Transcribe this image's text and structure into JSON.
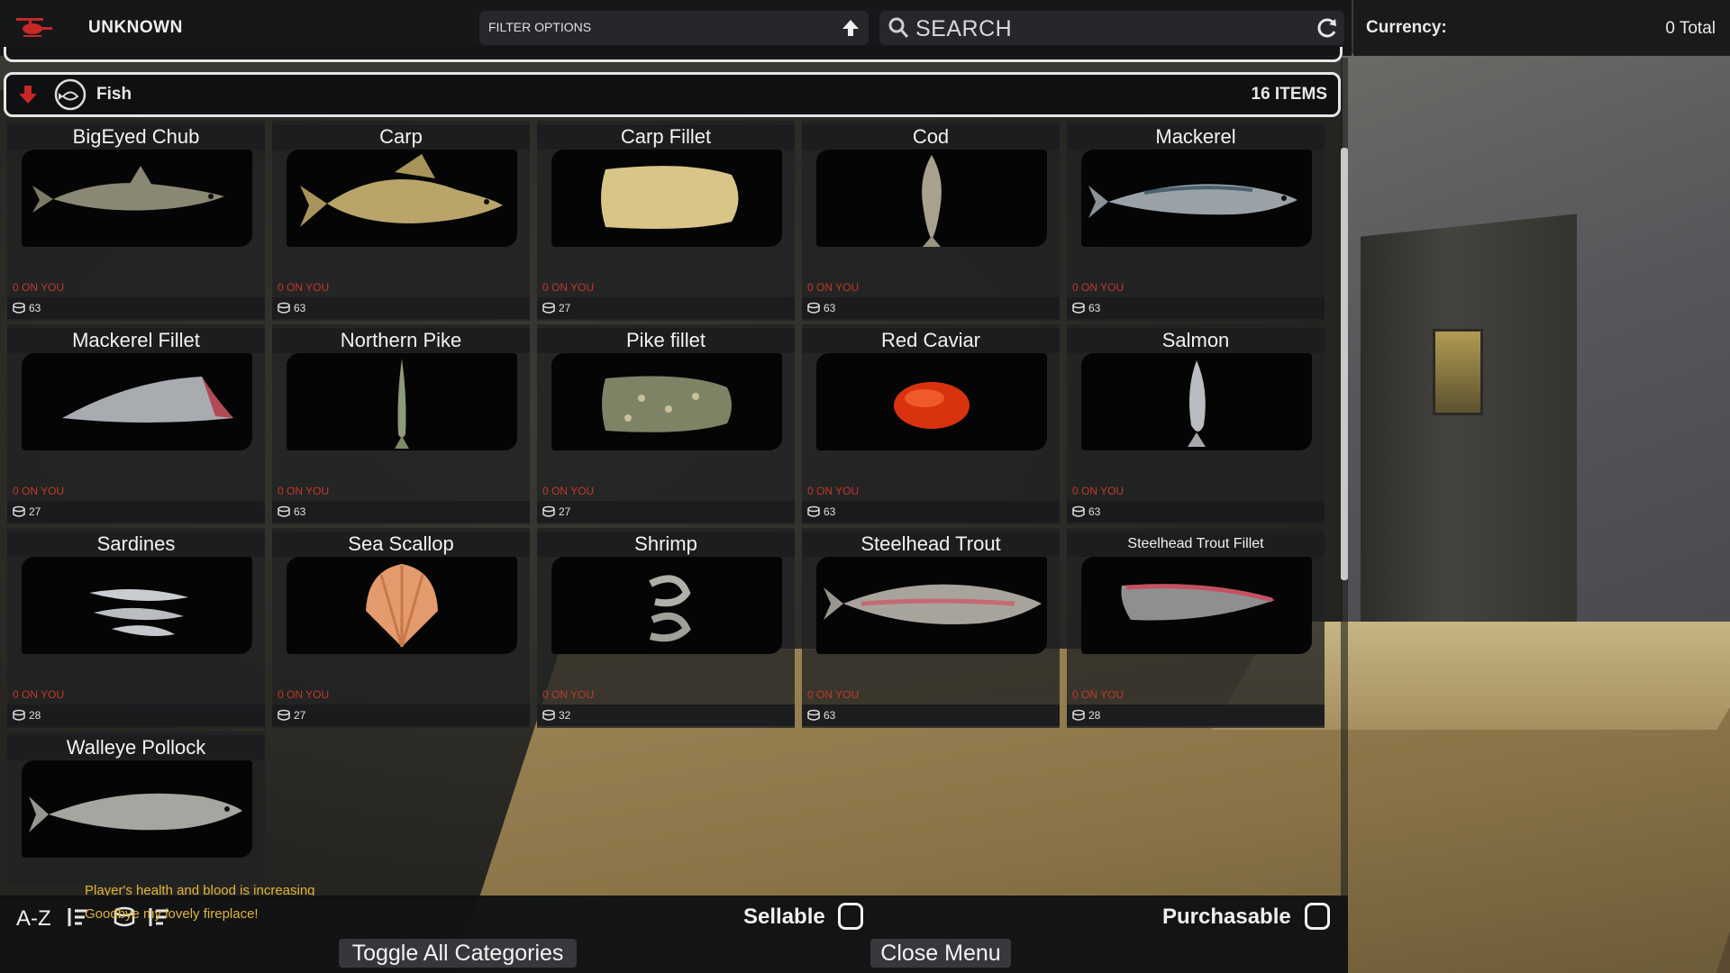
{
  "header": {
    "title": "UNKNOWN",
    "filter_label": "FILTER OPTIONS",
    "search_placeholder": "SEARCH"
  },
  "currency": {
    "label": "Currency:",
    "value": "0 Total"
  },
  "category": {
    "name": "Fish",
    "count_label": "16 ITEMS"
  },
  "items": [
    {
      "name": "BigEyed Chub",
      "on_you": "0 ON YOU",
      "price": "63",
      "icon": "bigeyed-chub-image"
    },
    {
      "name": "Carp",
      "on_you": "0 ON YOU",
      "price": "63",
      "icon": "carp-image"
    },
    {
      "name": "Carp Fillet",
      "on_you": "0 ON YOU",
      "price": "27",
      "icon": "carp-fillet-image"
    },
    {
      "name": "Cod",
      "on_you": "0 ON YOU",
      "price": "63",
      "icon": "cod-image"
    },
    {
      "name": "Mackerel",
      "on_you": "0 ON YOU",
      "price": "63",
      "icon": "mackerel-image"
    },
    {
      "name": "Mackerel Fillet",
      "on_you": "0 ON YOU",
      "price": "27",
      "icon": "mackerel-fillet-image"
    },
    {
      "name": "Northern Pike",
      "on_you": "0 ON YOU",
      "price": "63",
      "icon": "northern-pike-image"
    },
    {
      "name": "Pike fillet",
      "on_you": "0 ON YOU",
      "price": "27",
      "icon": "pike-fillet-image"
    },
    {
      "name": "Red Caviar",
      "on_you": "0 ON YOU",
      "price": "63",
      "icon": "red-caviar-image"
    },
    {
      "name": "Salmon",
      "on_you": "0 ON YOU",
      "price": "63",
      "icon": "salmon-image"
    },
    {
      "name": "Sardines",
      "on_you": "0 ON YOU",
      "price": "28",
      "icon": "sardines-image"
    },
    {
      "name": "Sea Scallop",
      "on_you": "0 ON YOU",
      "price": "27",
      "icon": "sea-scallop-image"
    },
    {
      "name": "Shrimp",
      "on_you": "0 ON YOU",
      "price": "32",
      "icon": "shrimp-image"
    },
    {
      "name": "Steelhead Trout",
      "on_you": "0 ON YOU",
      "price": "63",
      "icon": "steelhead-trout-image"
    },
    {
      "name": "Steelhead Trout Fillet",
      "on_you": "0 ON YOU",
      "price": "28",
      "icon": "steelhead-trout-fillet-image"
    },
    {
      "name": "Walleye Pollock",
      "on_you": "",
      "price": "",
      "icon": "walleye-pollock-image"
    }
  ],
  "notifications": [
    "Player's health and blood is increasing",
    "Goodbye my lovely fireplace!"
  ],
  "footer": {
    "sort_label": "A-Z",
    "sellable_label": "Sellable",
    "purchasable_label": "Purchasable",
    "toggle_categories_label": "Toggle All Categories",
    "close_menu_label": "Close Menu"
  },
  "colors": {
    "on_you_red": "#c0392b",
    "notification_yellow": "#e1b53a",
    "helicopter_red": "#c62828"
  }
}
